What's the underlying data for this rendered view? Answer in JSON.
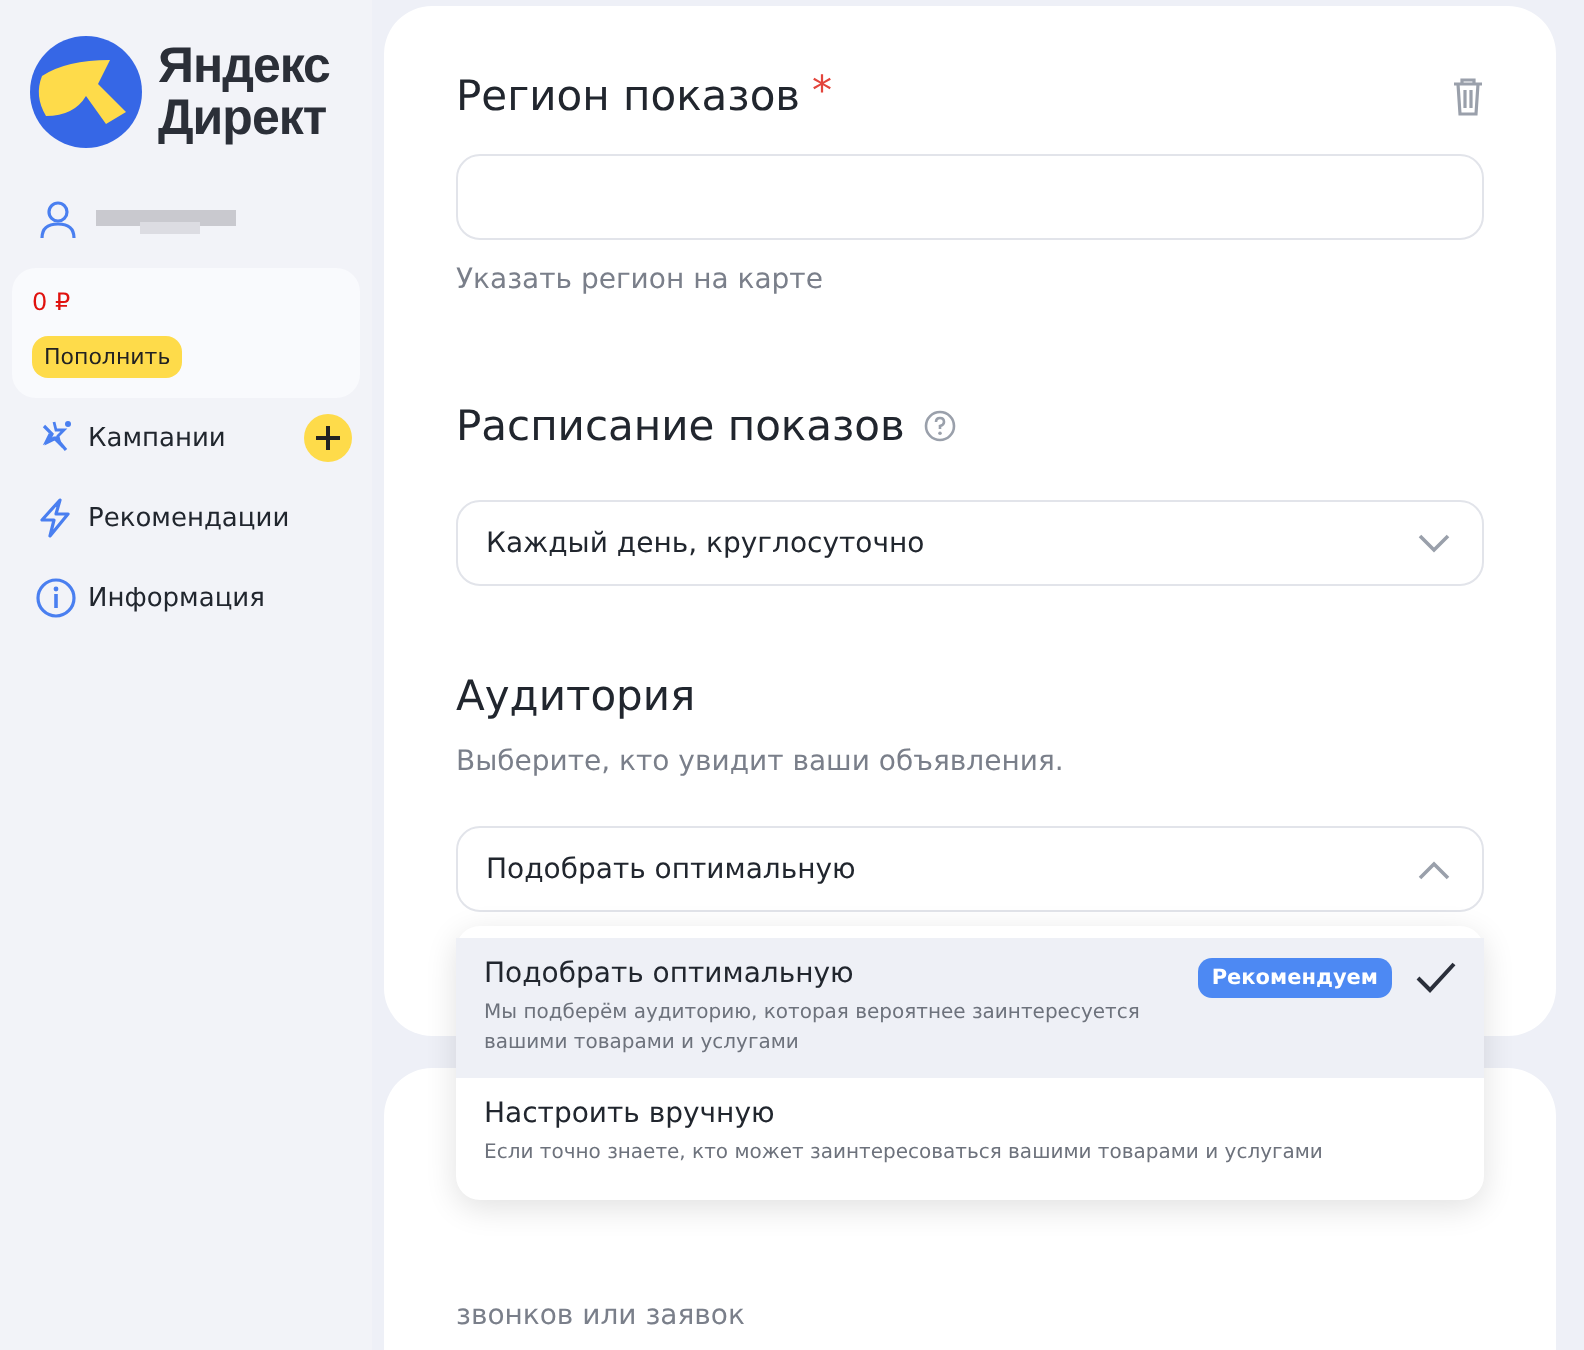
{
  "sidebar": {
    "logo": {
      "line1": "Яндекс",
      "line2": "Директ"
    },
    "balance": {
      "amount": "0 ₽",
      "button": "Пополнить"
    },
    "nav": [
      {
        "kind": "campaigns",
        "label": "Кампании",
        "add": true
      },
      {
        "kind": "recommendations",
        "label": "Рекомендации",
        "add": false
      },
      {
        "kind": "info",
        "label": "Информация",
        "add": false
      }
    ]
  },
  "region": {
    "title": "Регион показов",
    "required_mark": "*",
    "link": "Указать регион на карте"
  },
  "schedule": {
    "title": "Расписание показов",
    "help": true,
    "value": "Каждый день, круглосуточно",
    "expanded": false
  },
  "audience": {
    "title": "Аудитория",
    "subtitle": "Выберите, кто увидит ваши объявления.",
    "value": "Подобрать оптимальную",
    "expanded": true,
    "options": [
      {
        "title": "Подобрать оптимальную",
        "description": "Мы подберём аудиторию, которая вероятнее заинтересуется вашими товарами и услугами",
        "badge": "Рекомендуем",
        "selected": true
      },
      {
        "title": "Настроить вручную",
        "description": "Если точно знаете, кто может заинтересоваться вашими товарами и услугами",
        "selected": false
      }
    ]
  },
  "next_card": {
    "text": "звонков или заявок"
  }
}
